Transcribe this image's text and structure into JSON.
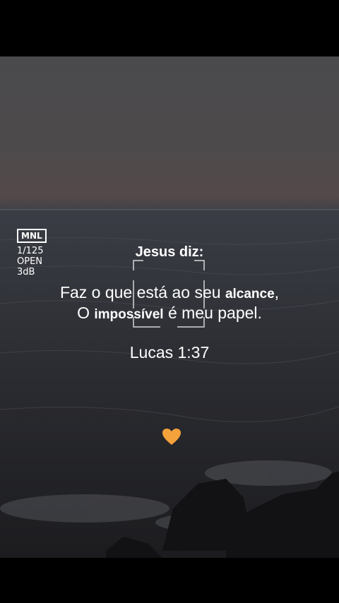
{
  "camera": {
    "mode": "MNL",
    "shutter": "1/125",
    "aperture": "OPEN",
    "gain": "3dB"
  },
  "text": {
    "title": "Jesus diz:",
    "line1_a": "Faz o que está ao seu ",
    "line1_b": "alcance",
    "line1_c": ",",
    "line2_a": "O ",
    "line2_b": "impossível",
    "line2_c": " é meu papel.",
    "reference": "Lucas 1:37"
  },
  "icons": {
    "heart": "orange-heart-icon"
  },
  "colors": {
    "heart": "#f4a23c"
  }
}
